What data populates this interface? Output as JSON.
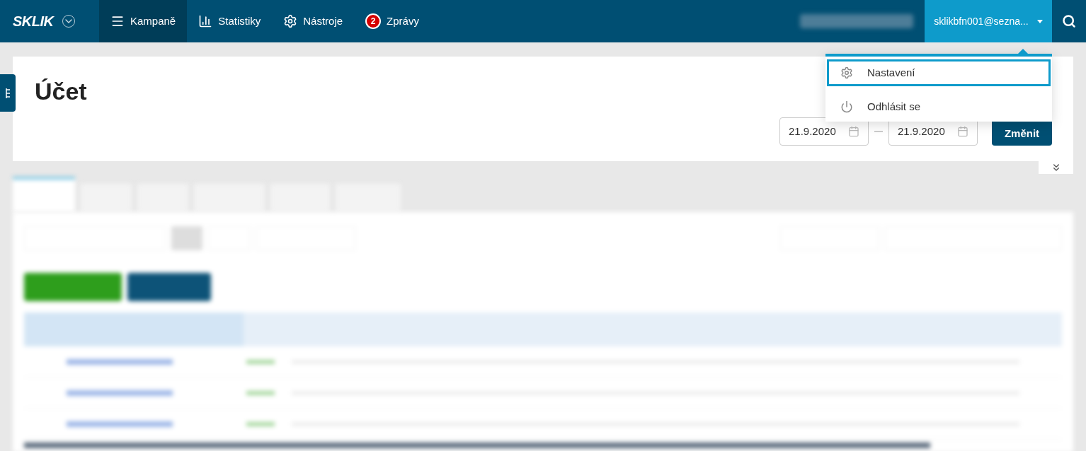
{
  "header": {
    "logo": "SKLIK",
    "nav": [
      {
        "label": "Kampaně",
        "selected": true
      },
      {
        "label": "Statistiky",
        "selected": false
      },
      {
        "label": "Nástroje",
        "selected": false
      },
      {
        "label": "Zprávy",
        "badge": "2",
        "selected": false
      }
    ],
    "account": "sklikbfn001@sezna..."
  },
  "user_menu": {
    "expanded": true,
    "items": [
      {
        "label": "Nastavení",
        "selected": true
      },
      {
        "label": "Odhlásit se",
        "selected": false
      }
    ]
  },
  "page": {
    "title": "Účet",
    "date_from": "21.9.2020",
    "date_to": "21.9.2020",
    "apply_button": "Změnit"
  }
}
